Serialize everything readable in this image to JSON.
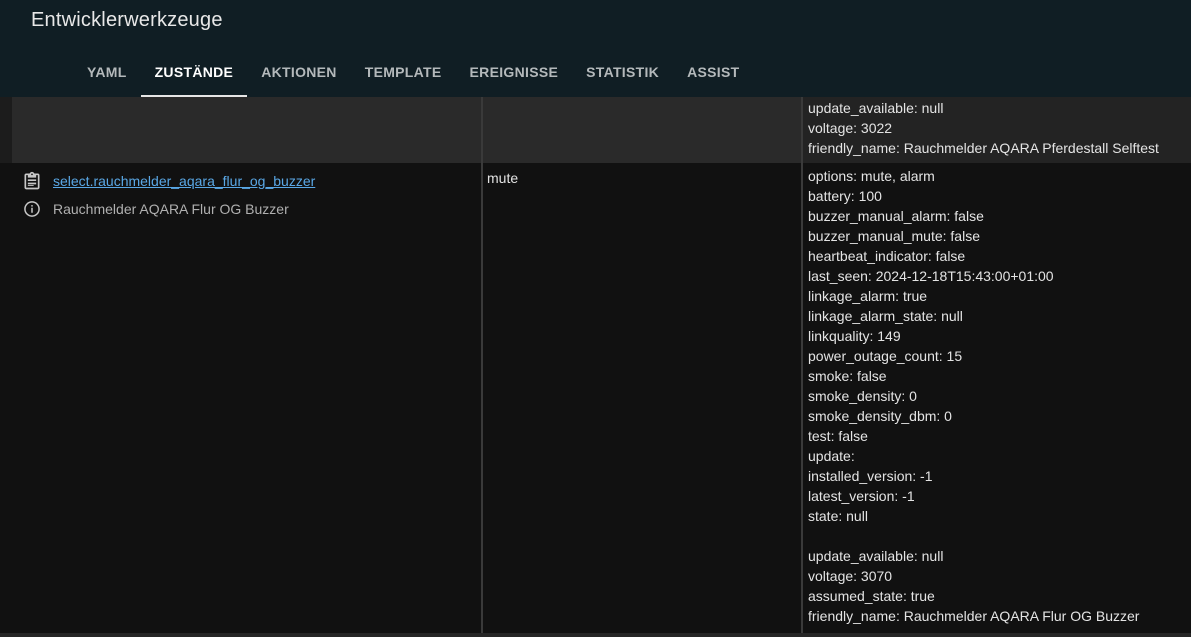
{
  "app": {
    "title": "Entwicklerwerkzeuge"
  },
  "tabs": [
    {
      "label": "YAML"
    },
    {
      "label": "ZUSTÄNDE",
      "active": true
    },
    {
      "label": "AKTIONEN"
    },
    {
      "label": "TEMPLATE"
    },
    {
      "label": "EREIGNISSE"
    },
    {
      "label": "STATISTIK"
    },
    {
      "label": "ASSIST"
    }
  ],
  "rows": [
    {
      "entity_id": "",
      "friendly_name": "",
      "state": "",
      "attributes": [
        "update_available: null",
        "voltage: 3022",
        "friendly_name: Rauchmelder AQARA Pferdestall Selftest"
      ]
    },
    {
      "entity_id": "select.rauchmelder_aqara_flur_og_buzzer",
      "friendly_name": "Rauchmelder AQARA Flur OG Buzzer",
      "state": "mute",
      "attributes": [
        "options: mute, alarm",
        "battery: 100",
        "buzzer_manual_alarm: false",
        "buzzer_manual_mute: false",
        "heartbeat_indicator: false",
        "last_seen: 2024-12-18T15:43:00+01:00",
        "linkage_alarm: true",
        "linkage_alarm_state: null",
        "linkquality: 149",
        "power_outage_count: 15",
        "smoke: false",
        "smoke_density: 0",
        "smoke_density_dbm: 0",
        "test: false",
        "update:",
        "installed_version: -1",
        "latest_version: -1",
        "state: null",
        "",
        "update_available: null",
        "voltage: 3070",
        "assumed_state: true",
        "friendly_name: Rauchmelder AQARA Flur OG Buzzer"
      ]
    }
  ],
  "icons": {
    "copy": "clipboard-text-icon",
    "info": "information-outline-icon"
  },
  "colors": {
    "header_bg": "#101e24",
    "link": "#5aa8e6",
    "active_tab_indicator": "#e6e6e6"
  }
}
